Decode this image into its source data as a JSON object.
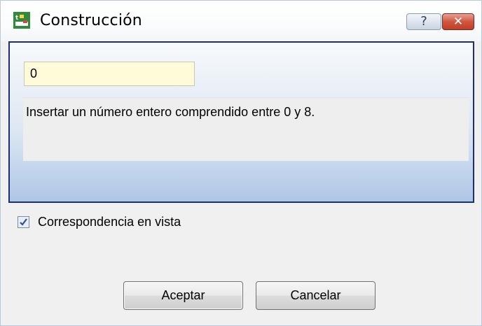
{
  "window": {
    "title": "Construcción"
  },
  "titlebar": {
    "help_label": "?",
    "close_label": "✕"
  },
  "panel": {
    "value": "0",
    "hint": "Insertar un número entero comprendido entre 0 y 8."
  },
  "option": {
    "label": "Correspondencia en vista",
    "checked": true
  },
  "buttons": {
    "accept": "Aceptar",
    "cancel": "Cancelar"
  }
}
